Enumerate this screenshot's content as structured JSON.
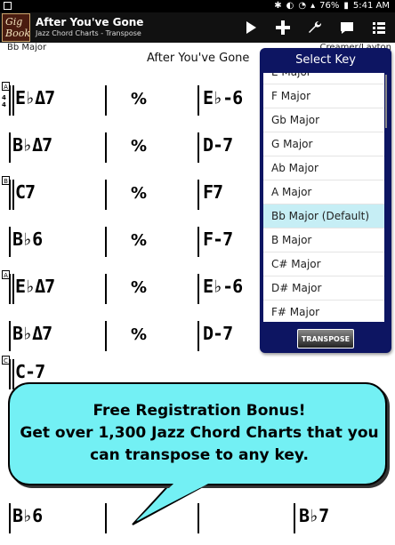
{
  "status_bar": {
    "battery": "76%",
    "time": "5:41 AM"
  },
  "app": {
    "logo_text": [
      "Gig",
      "Book"
    ],
    "title": "After You've Gone",
    "subtitle": "Jazz Chord Charts - Transpose"
  },
  "toolbar": {
    "icons": [
      "play-icon",
      "plus-icon",
      "wrench-icon",
      "comment-icon",
      "list-icon"
    ]
  },
  "sheet": {
    "key": "Bb Major",
    "composer": "Creamer/Layton",
    "song_title": "After You've Gone",
    "rows": [
      {
        "mark": "A",
        "timesig": [
          "4",
          "4"
        ],
        "chord1": "E♭Δ7",
        "chord2": "E♭-6"
      },
      {
        "mark": "",
        "chord1": "B♭Δ7",
        "chord2": "D-7"
      },
      {
        "mark": "B",
        "chord1": "C7",
        "chord2": "F7"
      },
      {
        "mark": "",
        "chord1": "B♭6",
        "chord2": "F-7"
      },
      {
        "mark": "A",
        "chord1": "E♭Δ7",
        "chord2": "E♭-6"
      },
      {
        "mark": "",
        "chord1": "B♭Δ7",
        "chord2": "D-7"
      },
      {
        "mark": "C",
        "chord1": "C-7",
        "chord2": ""
      },
      {
        "mark": "",
        "chord1": "B♭6",
        "chord2": "B♭7"
      }
    ],
    "repeat_symbol": "%"
  },
  "select_key": {
    "title": "Select Key",
    "items": [
      "E Major",
      "F Major",
      "Gb Major",
      "G Major",
      "Ab Major",
      "A Major",
      "Bb Major (Default)",
      "B Major",
      "C# Major",
      "D# Major",
      "F# Major"
    ],
    "selected_index": 6,
    "button": "TRANSPOSE"
  },
  "promo": {
    "line1": "Free Registration Bonus!",
    "line2": "Get over 1,300 Jazz Chord Charts that you",
    "line3": "can transpose to any key."
  },
  "colors": {
    "panel": "#0d1562",
    "bubble": "#73f0f4",
    "selected": "#c6eef5"
  }
}
